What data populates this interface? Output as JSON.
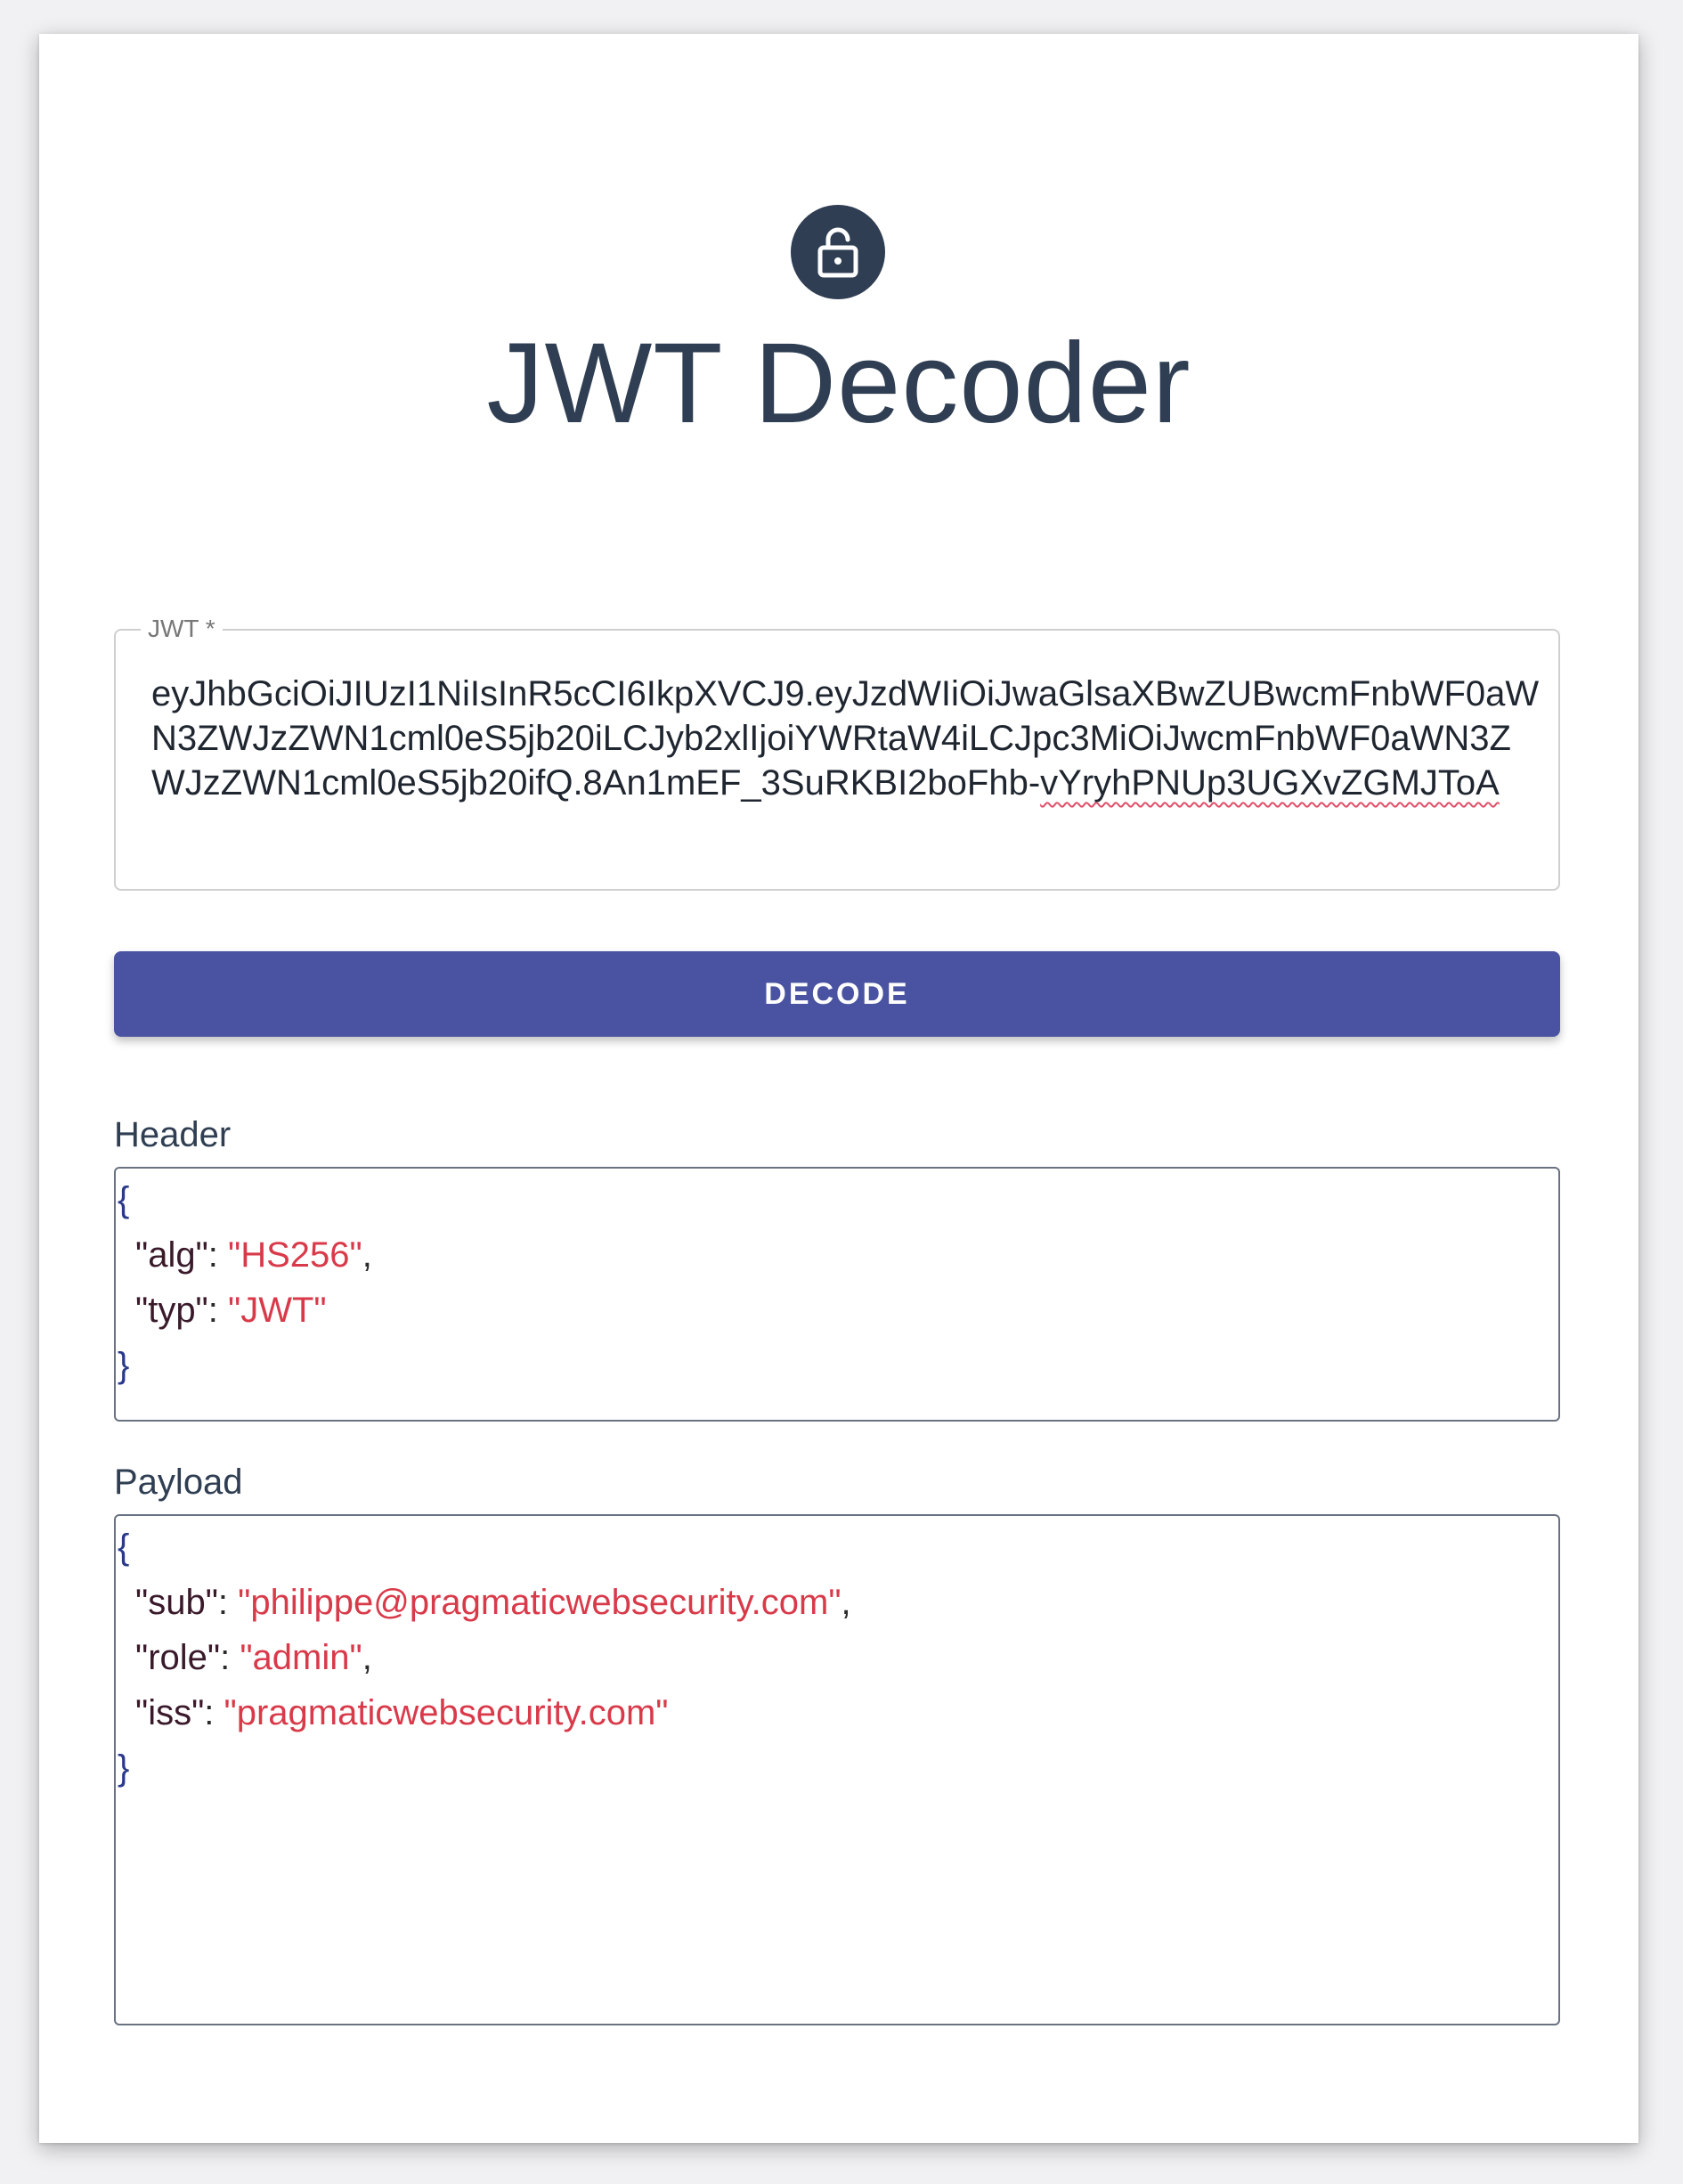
{
  "app": {
    "title": "JWT Decoder"
  },
  "jwt_input": {
    "label": "JWT *",
    "value_main": "eyJhbGciOiJIUzI1NiIsInR5cCI6IkpXVCJ9.eyJzdWIiOiJwaGlsaXBwZUBwcmFnbWF0aWN3ZWJzZWN1cml0eS5jb20iLCJyb2xlIjoiYWRtaW4iLCJpc3MiOiJwcmFnbWF0aWN3ZWJzZWN1cml0eS5jb20ifQ.8An1mEF_3SuRKBI2boFhb-",
    "value_tail": "vYryhPNUp3UGXvZGMJToA"
  },
  "decode_button": {
    "label": "DECODE"
  },
  "header_section": {
    "label": "Header",
    "open_brace": "{",
    "close_brace": "}",
    "entries": [
      {
        "key": "\"alg\"",
        "sep": ": ",
        "value": "\"HS256\"",
        "trail": ","
      },
      {
        "key": "\"typ\"",
        "sep": ": ",
        "value": "\"JWT\"",
        "trail": ""
      }
    ]
  },
  "payload_section": {
    "label": "Payload",
    "open_brace": "{",
    "close_brace": "}",
    "entries": [
      {
        "key": "\"sub\"",
        "sep": ": ",
        "value": "\"philippe@pragmaticwebsecurity.com\"",
        "trail": ","
      },
      {
        "key": "\"role\"",
        "sep": ": ",
        "value": "\"admin\"",
        "trail": ","
      },
      {
        "key": "\"iss\"",
        "sep": ": ",
        "value": "\"pragmaticwebsecurity.com\"",
        "trail": ""
      }
    ]
  },
  "icons": {
    "lock": "lock-open-icon"
  },
  "colors": {
    "primary": "#4a53a1",
    "avatar": "#2f3e52",
    "json_string": "#d93a4a",
    "json_key": "#3a1a2a",
    "json_brace": "#2a3a8a"
  }
}
